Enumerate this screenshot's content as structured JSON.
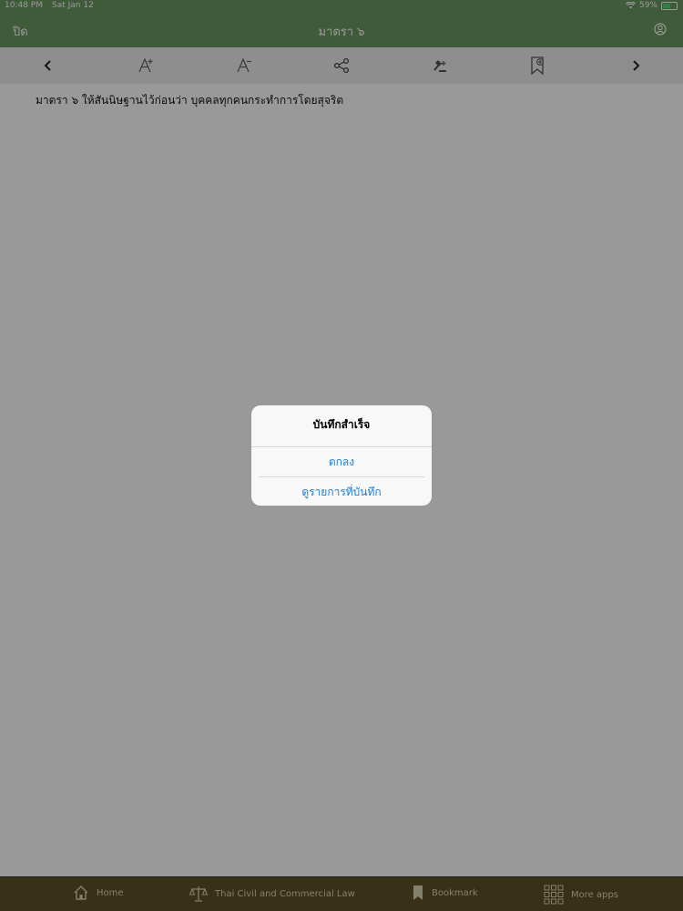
{
  "status_bar": {
    "time": "10:48 PM",
    "date": "Sat Jan 12",
    "battery": "59%",
    "battery_level": 0.59
  },
  "nav": {
    "close_label": "ปิด",
    "title": "มาตรา ๖"
  },
  "toolbar": {
    "icons": [
      "chevron-left-icon",
      "font-increase-icon",
      "font-decrease-icon",
      "share-icon",
      "gavel-icon",
      "bookmark-add-icon",
      "chevron-right-icon"
    ]
  },
  "content": {
    "text": "มาตรา ๖ ให้สันนิษฐานไว้ก่อนว่า บุคคลทุกคนกระทำการโดยสุจริต"
  },
  "alert": {
    "title": "บันทึกสำเร็จ",
    "ok_label": "ตกลง",
    "view_saved_label": "ดูรายการที่บันทึก"
  },
  "tab_bar": {
    "home": "Home",
    "law": "Thai Civil and Commercial Law",
    "bookmark": "Bookmark",
    "more": "More apps"
  },
  "colors": {
    "nav_green": "#6c9860",
    "tab_brown": "#5f5128",
    "alert_link": "#1a7fd6"
  }
}
